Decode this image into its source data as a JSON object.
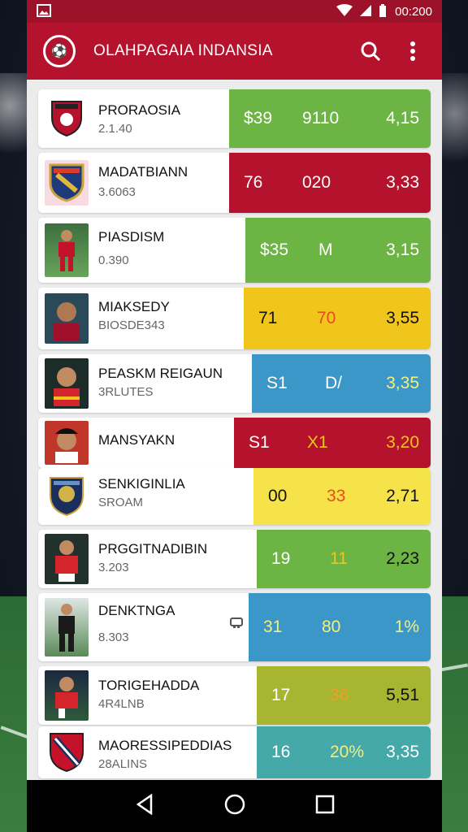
{
  "statusbar": {
    "time": "00:200"
  },
  "app": {
    "title": "OLAHPAGAIA INDANSIA"
  },
  "colors": {
    "red": "#b5132d",
    "green": "#6cb443",
    "yellow": "#f1c61c",
    "blue": "#3b97c8",
    "lightyellow": "#f6e34a",
    "olive": "#a7b531",
    "teal": "#44a9a8"
  },
  "rows": [
    {
      "name": "PRORAOSIA",
      "sub": "2.1.40",
      "v1": "$39",
      "v2": "9110",
      "v3": "4,15",
      "color": "#6cb443",
      "text": "#ffffff",
      "thumb": "shield-badge"
    },
    {
      "name": "MADATBIANN",
      "sub": "3.6063",
      "v1": "76",
      "v2": "020",
      "v3": "3,33",
      "color": "#b5132d",
      "text": "#ffffff",
      "thumb": "shield-badge"
    },
    {
      "name": "PIASDISM",
      "sub": "0.390",
      "v1": "$35",
      "v2": "M",
      "v3": "3,15",
      "color": "#6cb443",
      "text": "#ffffff",
      "thumb": "player-photo"
    },
    {
      "name": "MIAKSEDY",
      "sub": "BIOSDE343",
      "v1": "71",
      "v2": "70",
      "v3": "3,55",
      "color": "#f1c61c",
      "text": "#111111",
      "thumb": "player-photo"
    },
    {
      "name": "PEASKM REIGAUN",
      "sub": "3RLUTES",
      "v1": "S1",
      "v2": "D/",
      "v3": "3,35",
      "color": "#3b97c8",
      "text": "#ffffff",
      "thumb": "player-photo"
    },
    {
      "name": "MANSYAKN",
      "sub": "",
      "v1": "S1",
      "v2": "X1",
      "v3": "3,20",
      "color": "#b5132d",
      "text": "#ffffff",
      "thumb": "player-photo"
    },
    {
      "name": "SENKIGINLIA",
      "sub": "SROAM",
      "v1": "00",
      "v2": "33",
      "v3": "2,71",
      "color": "#f6e34a",
      "text": "#111111",
      "thumb": "shield-badge"
    },
    {
      "name": "PRGGITNADIBIN",
      "sub": "3.203",
      "v1": "19",
      "v2": "11",
      "v3": "2,23",
      "color": "#6cb443",
      "text": "#111111",
      "thumb": "player-photo"
    },
    {
      "name": "DENKTNGA",
      "sub": "8.303",
      "v1": "31",
      "v2": "80",
      "v3": "1%",
      "color": "#3b97c8",
      "text": "#f4ee7c",
      "thumb": "player-photo"
    },
    {
      "name": "TORIGEHADDA",
      "sub": "4R4LNB",
      "v1": "17",
      "v2": "36",
      "v3": "5,51",
      "color": "#a7b531",
      "text": "#111111",
      "thumb": "player-photo"
    },
    {
      "name": "MAORESSIPEDDIAS",
      "sub": "28ALINS",
      "v1": "16",
      "v2": "20%",
      "v3": "3,35",
      "color": "#44a9a8",
      "text": "#ffffff",
      "thumb": "shield-badge"
    }
  ]
}
